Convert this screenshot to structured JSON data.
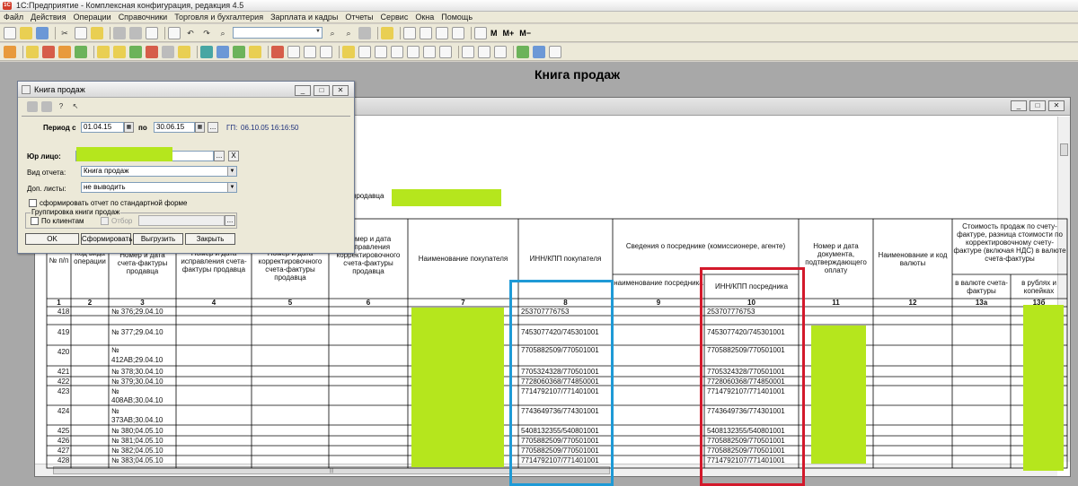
{
  "app": {
    "title": "1С:Предприятие - Комплексная конфигурация, редакция 4.5",
    "menu": [
      "Файл",
      "Действия",
      "Операции",
      "Справочники",
      "Торговля и бухгалтерия",
      "Зарплата и кадры",
      "Отчеты",
      "Сервис",
      "Окна",
      "Помощь"
    ],
    "toolbar_m_buttons": [
      "M",
      "M+",
      "M−"
    ]
  },
  "report": {
    "title": "Книга продаж",
    "seller_label_tail": "продавца",
    "headers": {
      "col1": "№ п/п",
      "col2": "Код вида операции",
      "col3": "Номер и дата счета-фактуры продавца",
      "col4": "Номер и дата исправления счета-фактуры продавца",
      "col5": "Номер и дата корректировочного счета-фактуры продавца",
      "col6": "Номер и дата исправления корректировочного счета-фактуры продавца",
      "col7": "Наименование покупателя",
      "col8": "ИНН/КПП покупателя",
      "col9_10_group": "Сведения о посреднике (комиссионере, агенте)",
      "col9": "наименование посредника",
      "col10": "ИНН/КПП посредника",
      "col11": "Номер и дата документа, подтверждающего оплату",
      "col12": "Наименование и код валюты",
      "col13_group": "Стоимость продаж по счету-фактуре, разница стоимости по корректировочному счету-фактуре (включая НДС) в валюте счета-фактуры",
      "col13a": "в валюте счета-фактуры",
      "col13b": "в рублях и копейках"
    },
    "col_numbers": [
      "1",
      "2",
      "3",
      "4",
      "5",
      "6",
      "7",
      "8",
      "9",
      "10",
      "11",
      "12",
      "13а",
      "13б"
    ],
    "rows": [
      {
        "n": "418",
        "doc": "№ 376;29.04.10",
        "inn": "253707776753",
        "agent_inn": "253707776753"
      },
      {
        "n": "419",
        "doc": "№ 377;29.04.10",
        "inn": "7453077420/745301001",
        "agent_inn": "7453077420/745301001"
      },
      {
        "n": "420",
        "doc_l1": "№",
        "doc_l2": "412АВ;29.04.10",
        "inn": "7705882509/770501001",
        "agent_inn": "7705882509/770501001"
      },
      {
        "n": "421",
        "doc": "№ 378;30.04.10",
        "inn": "7705324328/770501001",
        "agent_inn": "7705324328/770501001"
      },
      {
        "n": "422",
        "doc": "№ 379;30.04.10",
        "inn": "7728060368/774850001",
        "agent_inn": "7728060368/774850001"
      },
      {
        "n": "423",
        "doc_l1": "№",
        "doc_l2": "408АВ;30.04.10",
        "inn": "7714792107/771401001",
        "agent_inn": "7714792107/771401001"
      },
      {
        "n": "424",
        "doc_l1": "№",
        "doc_l2": "373АВ;30.04.10",
        "inn": "7743649736/774301001",
        "agent_inn": "7743649736/774301001"
      },
      {
        "n": "425",
        "doc": "№ 380;04.05.10",
        "inn": "5408132355/540801001",
        "agent_inn": "5408132355/540801001"
      },
      {
        "n": "426",
        "doc": "№ 381;04.05.10",
        "inn": "7705882509/770501001",
        "agent_inn": "7705882509/770501001"
      },
      {
        "n": "427",
        "doc": "№ 382;04.05.10",
        "inn": "7705882509/770501001",
        "agent_inn": "7705882509/770501001"
      },
      {
        "n": "428",
        "doc": "№ 383;04.05.10",
        "inn": "7714792107/771401001",
        "agent_inn": "7714792107/771401001"
      }
    ]
  },
  "dialog": {
    "title": "Книга продаж",
    "period_label": "Период с",
    "period_from": "01.04.15",
    "period_to_label": "по",
    "period_to": "30.06.15",
    "gp_label": "ГП:",
    "gp_value": "06.10.05 16:16:50",
    "entity_label": "Юр лицо:",
    "report_type_label": "Вид отчета:",
    "report_type_value": "Книга продаж",
    "extra_sheets_label": "Доп. листы:",
    "extra_sheets_value": "не выводить",
    "standard_form_label": "сформировать отчет по стандартной форме",
    "grouping_label": "Группировка книги продаж",
    "by_clients_label": "По клиентам",
    "filter_label": "Отбор",
    "buttons": {
      "ok": "OK",
      "generate": "Сформировать",
      "export": "Выгрузить",
      "close": "Закрыть"
    },
    "ellipsis": "...",
    "clear": "X"
  },
  "colors": {
    "redaction_green": "#b5e61d",
    "highlight_blue": "#1e9ad6",
    "highlight_red": "#d3192b"
  }
}
